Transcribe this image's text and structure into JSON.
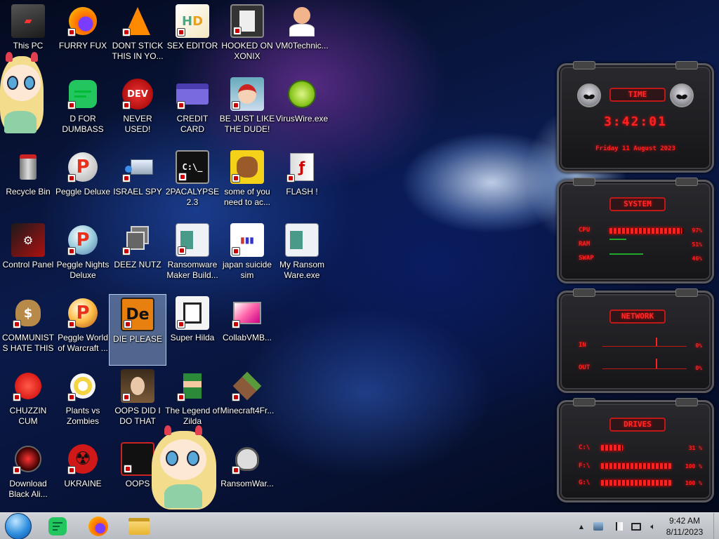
{
  "desktop": {
    "icons": [
      {
        "label": "This PC",
        "icon": "computer-icon"
      },
      {
        "label": "FURRY FUX",
        "icon": "firefox-icon"
      },
      {
        "label": "DONT STICK THIS IN YO...",
        "icon": "vlc-cone-icon"
      },
      {
        "label": "SEX EDITOR",
        "icon": "hxd-editor-icon"
      },
      {
        "label": "HOOKED ON XONIX",
        "icon": "xonix-game-icon"
      },
      {
        "label": "VM0Technic...",
        "icon": "doctor-person-icon"
      },
      {
        "label": "D FOR DUMBASS",
        "icon": "green-chat-icon"
      },
      {
        "label": "NEVER USED!",
        "icon": "dev-cpp-icon"
      },
      {
        "label": "CREDIT CARD CHECKER",
        "icon": "credit-card-icon"
      },
      {
        "label": "BE JUST LIKE THE DUDE!",
        "icon": "santa-elf-icon"
      },
      {
        "label": "VirusWire.exe",
        "icon": "lime-icon"
      },
      {
        "label": "Recycle Bin",
        "icon": "recycle-bin-icon"
      },
      {
        "label": "Peggle Deluxe",
        "icon": "peggle-icon"
      },
      {
        "label": "ISRAEL SPY",
        "icon": "network-spy-icon"
      },
      {
        "label": "2PACALYPSE 2.3",
        "icon": "terminal-icon"
      },
      {
        "label": "some of you need to ac...",
        "icon": "dog-icon"
      },
      {
        "label": "FLASH !",
        "icon": "flash-player-icon"
      },
      {
        "label": "Control Panel",
        "icon": "control-panel-icon"
      },
      {
        "label": "Peggle Nights Deluxe",
        "icon": "peggle-nights-icon"
      },
      {
        "label": "DEEZ NUTZ",
        "icon": "stacked-windows-icon"
      },
      {
        "label": "Ransomware Maker Build...",
        "icon": "application-window-icon"
      },
      {
        "label": "japan suicide sim",
        "icon": "sim-game-icon"
      },
      {
        "label": "My Ransom Ware.exe",
        "icon": "application-window-icon"
      },
      {
        "label": "COMMUNISTS HATE THIS G...",
        "icon": "money-bag-icon"
      },
      {
        "label": "Peggle World of Warcraft ...",
        "icon": "peggle-wow-icon"
      },
      {
        "label": "DIE PLEASE",
        "icon": "die-app-icon"
      },
      {
        "label": "Super Hilda",
        "icon": "pixel-character-icon"
      },
      {
        "label": "CollabVMB...",
        "icon": "monitor-app-icon"
      },
      {
        "label": "CHUZZIN CUM",
        "icon": "chuzzle-icon"
      },
      {
        "label": "Plants vs Zombies",
        "icon": "flower-plant-icon"
      },
      {
        "label": "OOPS DID I DO THAT",
        "icon": "portrait-painting-icon"
      },
      {
        "label": "The Legend of Zilda",
        "icon": "pixel-hero-icon"
      },
      {
        "label": "Minecraft4Fr...",
        "icon": "grass-block-icon"
      },
      {
        "label": "Download Black Ali...",
        "icon": "alien-red-icon"
      },
      {
        "label": "UKRAINE",
        "icon": "radiation-icon"
      },
      {
        "label": "OOPS",
        "icon": "dark-app-icon"
      },
      {
        "label": "RansomWar...",
        "icon": "skull-icon"
      }
    ]
  },
  "widget": {
    "time": {
      "title": "TIME",
      "clock": "3:42:01",
      "date": "Friday 11 August 2023"
    },
    "system": {
      "title": "SYSTEM",
      "rows": [
        {
          "label": "CPU",
          "value": "97%",
          "percent": 97
        },
        {
          "label": "RAM",
          "value": "51%",
          "percent": 51
        },
        {
          "label": "SWAP",
          "value": "46%",
          "percent": 46
        }
      ]
    },
    "network": {
      "title": "NETWORK",
      "rows": [
        {
          "label": "IN",
          "value": "0%"
        },
        {
          "label": "OUT",
          "value": "0%"
        }
      ]
    },
    "drives": {
      "title": "DRIVES",
      "rows": [
        {
          "label": "C:\\",
          "value": "31 %",
          "percent": 31
        },
        {
          "label": "F:\\",
          "value": "100 %",
          "percent": 100
        },
        {
          "label": "G:\\",
          "value": "100 %",
          "percent": 100
        }
      ]
    }
  },
  "taskbar": {
    "pinned": [
      {
        "name": "green-chat-icon"
      },
      {
        "name": "firefox-icon"
      },
      {
        "name": "file-explorer-icon"
      }
    ],
    "tray": {
      "overflow_glyph": "▲",
      "clock_time": "9:42 AM",
      "clock_date": "8/11/2023"
    }
  },
  "colors": {
    "widget_red": "#ff2020",
    "taskbar_bg": "#c8ccd2",
    "selection": "#aac8eb"
  }
}
